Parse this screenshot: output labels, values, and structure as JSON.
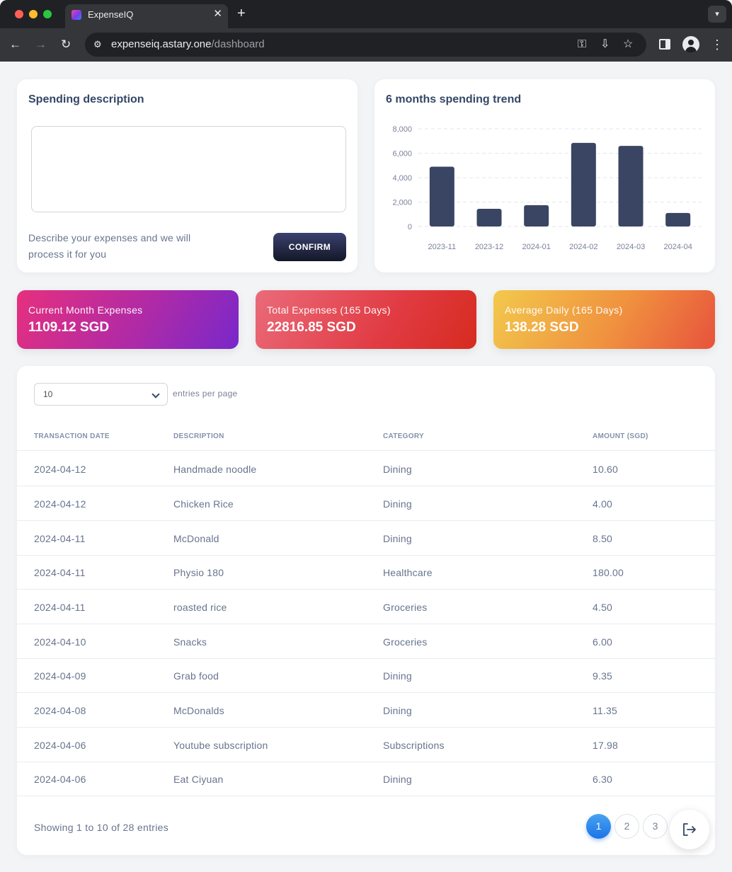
{
  "browser": {
    "tab_title": "ExpenseIQ",
    "url_domain": "expenseiq.astary.one",
    "url_path": "/dashboard"
  },
  "description_card": {
    "title": "Spending description",
    "textarea_value": "",
    "hint": "Describe your expenses and we will process it for you",
    "confirm_label": "CONFIRM"
  },
  "trend_card": {
    "title": "6 months spending trend"
  },
  "chart_data": {
    "type": "bar",
    "title": "6 months spending trend",
    "categories": [
      "2023-11",
      "2023-12",
      "2024-01",
      "2024-02",
      "2024-03",
      "2024-04"
    ],
    "values": [
      4900,
      1450,
      1750,
      6850,
      6600,
      1109.12
    ],
    "ylim": [
      0,
      8000
    ],
    "yticks": [
      0,
      2000,
      4000,
      6000,
      8000
    ],
    "ytick_labels": [
      "0",
      "2,000",
      "4,000",
      "6,000",
      "8,000"
    ],
    "grid": true,
    "bar_color": "#3a4563"
  },
  "stats": [
    {
      "label": "Current Month Expenses",
      "value": "1109.12 SGD"
    },
    {
      "label": "Total Expenses (165 Days)",
      "value": "22816.85 SGD"
    },
    {
      "label": "Average Daily (165 Days)",
      "value": "138.28 SGD"
    }
  ],
  "table": {
    "entries_per_page": "10",
    "entries_label": "entries per page",
    "headers": [
      "TRANSACTION DATE",
      "DESCRIPTION",
      "CATEGORY",
      "AMOUNT (SGD)"
    ],
    "rows": [
      [
        "2024-04-12",
        "Handmade noodle",
        "Dining",
        "10.60"
      ],
      [
        "2024-04-12",
        "Chicken Rice",
        "Dining",
        "4.00"
      ],
      [
        "2024-04-11",
        "McDonald",
        "Dining",
        "8.50"
      ],
      [
        "2024-04-11",
        "Physio 180",
        "Healthcare",
        "180.00"
      ],
      [
        "2024-04-11",
        "roasted rice",
        "Groceries",
        "4.50"
      ],
      [
        "2024-04-10",
        "Snacks",
        "Groceries",
        "6.00"
      ],
      [
        "2024-04-09",
        "Grab food",
        "Dining",
        "9.35"
      ],
      [
        "2024-04-08",
        "McDonalds",
        "Dining",
        "11.35"
      ],
      [
        "2024-04-06",
        "Youtube subscription",
        "Subscriptions",
        "17.98"
      ],
      [
        "2024-04-06",
        "Eat Ciyuan",
        "Dining",
        "6.30"
      ]
    ],
    "footer": "Showing 1 to 10 of 28 entries",
    "pages": [
      "1",
      "2",
      "3"
    ],
    "active_page": "1"
  },
  "colors": {
    "accent": "#1a73e8",
    "confirm_button": "#3a416f",
    "bar": "#3a4563"
  }
}
